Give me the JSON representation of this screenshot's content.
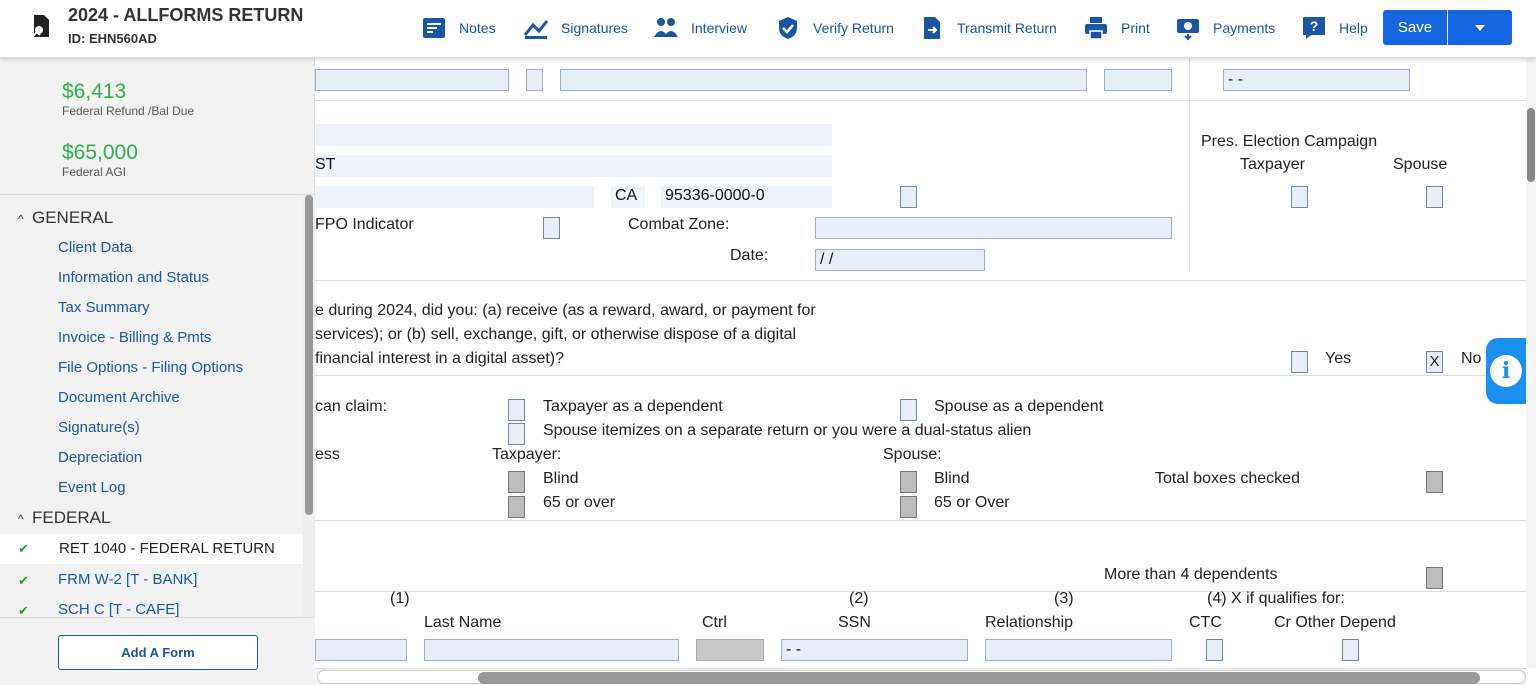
{
  "header": {
    "title": "2024 - ALLFORMS RETURN",
    "id_line": "ID: EHN560AD",
    "nav": [
      {
        "label": "Notes",
        "icon": "notes-icon"
      },
      {
        "label": "Signatures",
        "icon": "signature-icon"
      },
      {
        "label": "Interview",
        "icon": "interview-icon"
      },
      {
        "label": "Verify Return",
        "icon": "verify-shield-icon"
      },
      {
        "label": "Transmit Return",
        "icon": "transmit-icon"
      },
      {
        "label": "Print",
        "icon": "printer-icon"
      },
      {
        "label": "Payments",
        "icon": "payments-icon"
      },
      {
        "label": "Help",
        "icon": "help-icon"
      }
    ],
    "save_label": "Save"
  },
  "sidebar": {
    "refund_amount": "$6,413",
    "refund_label": "Federal Refund /Bal Due",
    "agi_amount": "$65,000",
    "agi_label": "Federal AGI",
    "sections": {
      "general": "GENERAL",
      "federal": "FEDERAL"
    },
    "general_items": [
      "Client Data",
      "Information and Status",
      "Tax Summary",
      "Invoice - Billing & Pmts",
      "File Options - Filing Options",
      "Document Archive",
      "Signature(s)",
      "Depreciation",
      "Event Log"
    ],
    "federal_items": [
      "RET 1040 - FEDERAL RETURN",
      "FRM W-2 [T - BANK]",
      "SCH C [T - CAFE]"
    ],
    "add_form": "Add A Form"
  },
  "form": {
    "ssn_right": "-  -",
    "address_line2": "ST",
    "state": "CA",
    "zip": "95336-0000-0",
    "fpo_label": "FPO Indicator",
    "combat_zone": "Combat Zone:",
    "date_label": "Date:",
    "date_value": "/  /",
    "pres_election": "Pres. Election Campaign",
    "taxpayer": "Taxpayer",
    "spouse": "Spouse",
    "digital_q1": "e during 2024, did you: (a) receive (as a reward, award, or payment for",
    "digital_q2": "services); or (b) sell, exchange, gift, or otherwise dispose of a digital",
    "digital_q3": "financial interest in a digital asset)?",
    "yes": "Yes",
    "no": "No",
    "no_checked": "X",
    "can_claim": "can claim:",
    "tp_dependent": "Taxpayer as a dependent",
    "sp_dependent": "Spouse as a dependent",
    "sp_itemizes": "Spouse itemizes on a separate return or you were a dual-status alien",
    "ess": "ess",
    "taxpayer_colon": "Taxpayer:",
    "spouse_colon": "Spouse:",
    "blind": "Blind",
    "over65_tp": "65 or over",
    "over65_sp": "65 or Over",
    "total_boxes": "Total boxes checked",
    "more_than_4": "More than 4 dependents",
    "col1": "(1)",
    "col2": "(2)",
    "col3": "(3)",
    "col4": "(4) X if qualifies for:",
    "last_name": "Last Name",
    "ctrl": "Ctrl",
    "ssn": "SSN",
    "relationship": "Relationship",
    "ctc": "CTC",
    "cr_other": "Cr Other Depend",
    "dep_ssn": "-  -"
  }
}
